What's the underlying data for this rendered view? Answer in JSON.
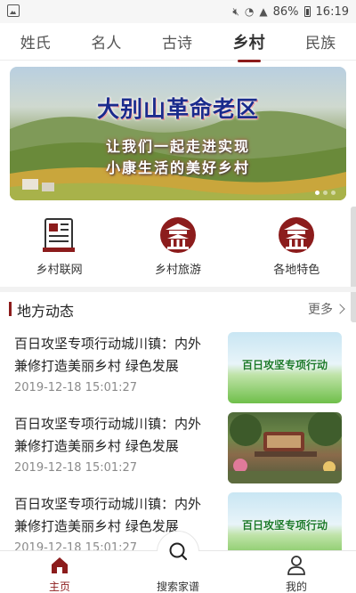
{
  "status_bar": {
    "battery": "86%",
    "time": "16:19"
  },
  "tabs": [
    {
      "label": "姓氏",
      "active": false
    },
    {
      "label": "名人",
      "active": false
    },
    {
      "label": "古诗",
      "active": false
    },
    {
      "label": "乡村",
      "active": true
    },
    {
      "label": "民族",
      "active": false
    }
  ],
  "banner": {
    "title": "大别山革命老区",
    "line1": "让我们一起走进实现",
    "line2": "小康生活的美好乡村"
  },
  "quick_menu": [
    {
      "label": "乡村联网",
      "icon": "newspaper-icon"
    },
    {
      "label": "乡村旅游",
      "icon": "pavilion-icon"
    },
    {
      "label": "各地特色",
      "icon": "pavilion-icon"
    }
  ],
  "section": {
    "title": "地方动态",
    "more": "更多"
  },
  "news": [
    {
      "title": "百日攻坚专项行动城川镇：内外兼修打造美丽乡村 绿色发展",
      "time": "2019-12-18 15:01:27",
      "thumb_text": "百日攻坚专项行动"
    },
    {
      "title": "百日攻坚专项行动城川镇：内外兼修打造美丽乡村 绿色发展",
      "time": "2019-12-18 15:01:27",
      "thumb_text": ""
    },
    {
      "title": "百日攻坚专项行动城川镇：内外兼修打造美丽乡村 绿色发展",
      "time": "2019-12-18 15:01:27",
      "thumb_text": "百日攻坚专项行动"
    }
  ],
  "bottom_nav": {
    "home": "主页",
    "search": "搜索家谱",
    "mine": "我的"
  },
  "colors": {
    "accent": "#8c1c1c",
    "banner_title": "#1a2b8c"
  }
}
